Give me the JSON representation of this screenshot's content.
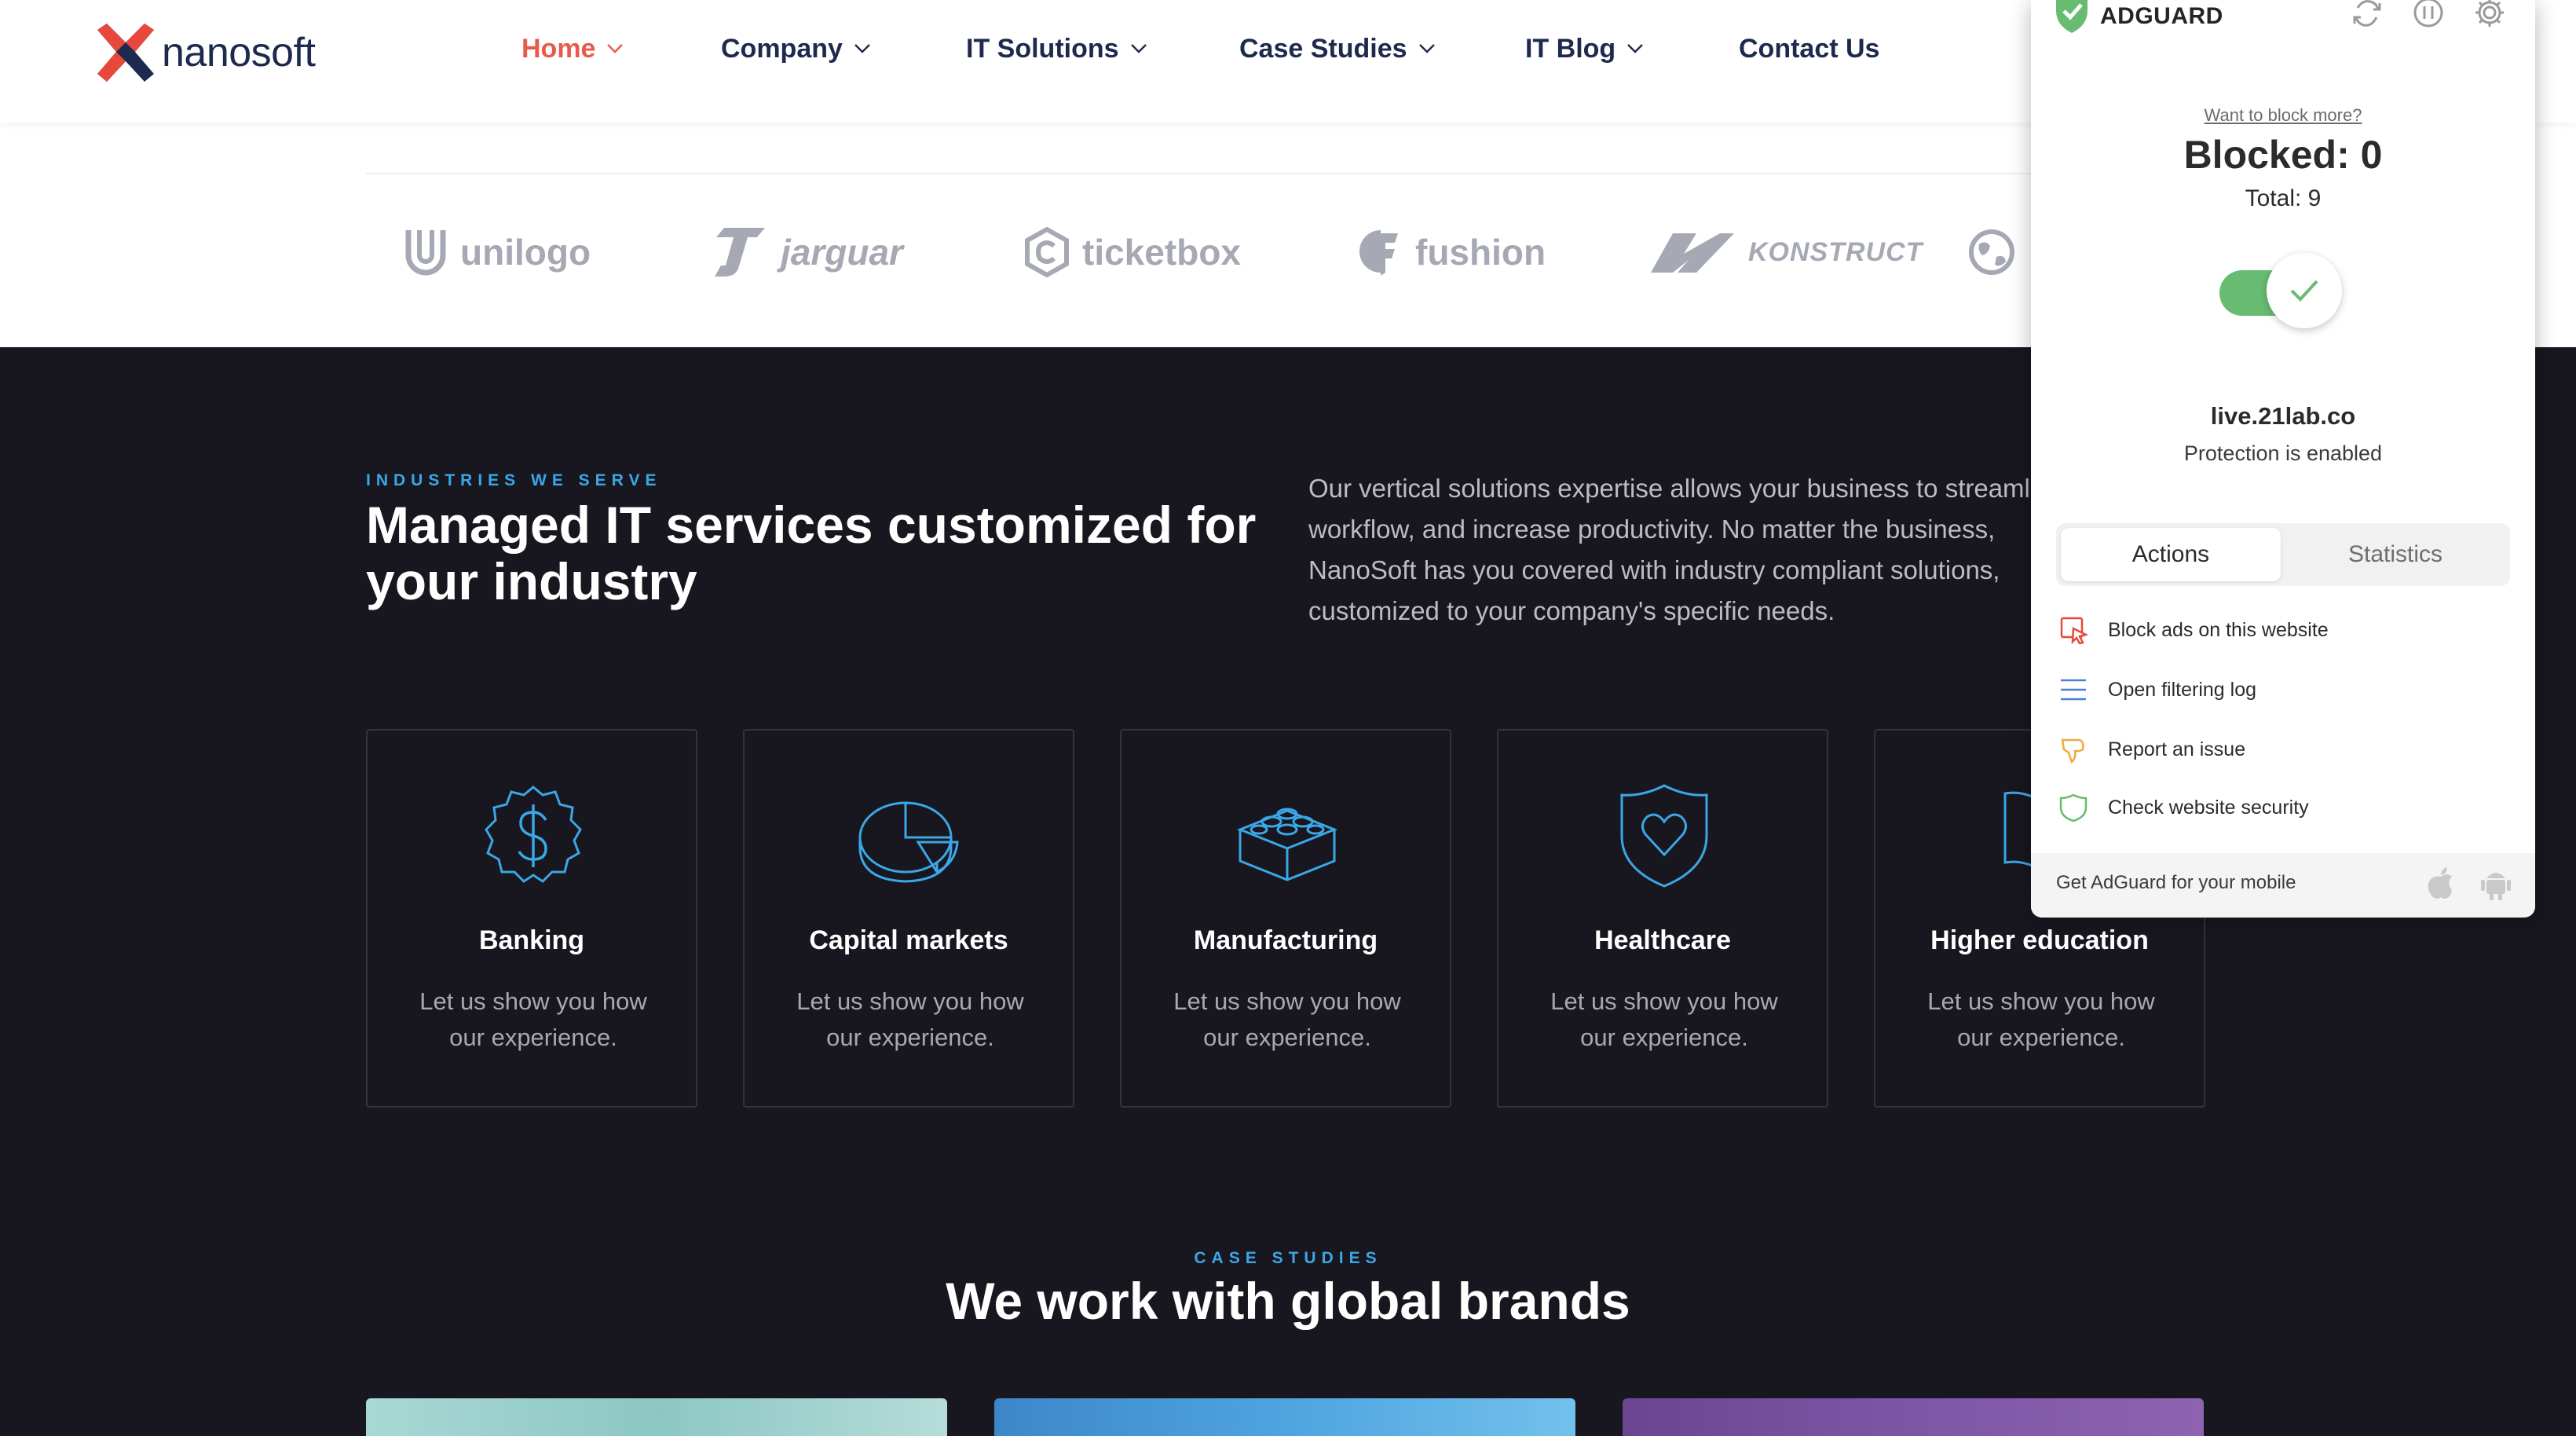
{
  "nav": {
    "brand": "nanosoft",
    "items": [
      {
        "label": "Home",
        "active": true,
        "dropdown": true
      },
      {
        "label": "Company",
        "dropdown": true
      },
      {
        "label": "IT Solutions",
        "dropdown": true
      },
      {
        "label": "Case Studies",
        "dropdown": true
      },
      {
        "label": "IT Blog",
        "dropdown": true
      },
      {
        "label": "Contact Us",
        "dropdown": false
      }
    ]
  },
  "logos": [
    "unilogo",
    "jarguar",
    "ticketbox",
    "fushion",
    "KONSTRUCT"
  ],
  "industries": {
    "eyebrow": "INDUSTRIES WE SERVE",
    "title_line1": "Managed IT services customized for",
    "title_line2": "your industry",
    "intro": "Our vertical solutions expertise allows your business to streamline workflow, and increase productivity. No matter the business, NanoSoft has you covered with industry compliant solutions, customized to your company's specific needs.",
    "cards": [
      {
        "title": "Banking",
        "desc": "Let us show you how our experience.",
        "icon": "dollar-badge-icon"
      },
      {
        "title": "Capital markets",
        "desc": "Let us show you how our experience.",
        "icon": "pie-chart-icon"
      },
      {
        "title": "Manufacturing",
        "desc": "Let us show you how our experience.",
        "icon": "building-block-icon"
      },
      {
        "title": "Healthcare",
        "desc": "Let us show you how our experience.",
        "icon": "heart-shield-icon"
      },
      {
        "title": "Higher education",
        "desc": "Let us show you how our experience.",
        "icon": "book-icon"
      }
    ]
  },
  "case_studies": {
    "eyebrow": "CASE STUDIES",
    "title": "We work with global brands"
  },
  "adguard": {
    "brand": "ADGUARD",
    "want_more": "Want to block more?",
    "blocked": "Blocked: 0",
    "total": "Total: 9",
    "site": "live.21lab.co",
    "status": "Protection is enabled",
    "tabs": {
      "actions": "Actions",
      "statistics": "Statistics"
    },
    "actions": [
      {
        "label": "Block ads on this website",
        "icon": "block-cursor-icon"
      },
      {
        "label": "Open filtering log",
        "icon": "list-icon"
      },
      {
        "label": "Report an issue",
        "icon": "thumbs-down-icon"
      },
      {
        "label": "Check website security",
        "icon": "shield-icon"
      }
    ],
    "footer": "Get AdGuard for your mobile"
  },
  "colors": {
    "accent_red": "#e85a4a",
    "navy": "#1d2a4e",
    "dark_bg": "#18161f",
    "sky_blue": "#3aa7e6",
    "adguard_green": "#68bc71"
  }
}
